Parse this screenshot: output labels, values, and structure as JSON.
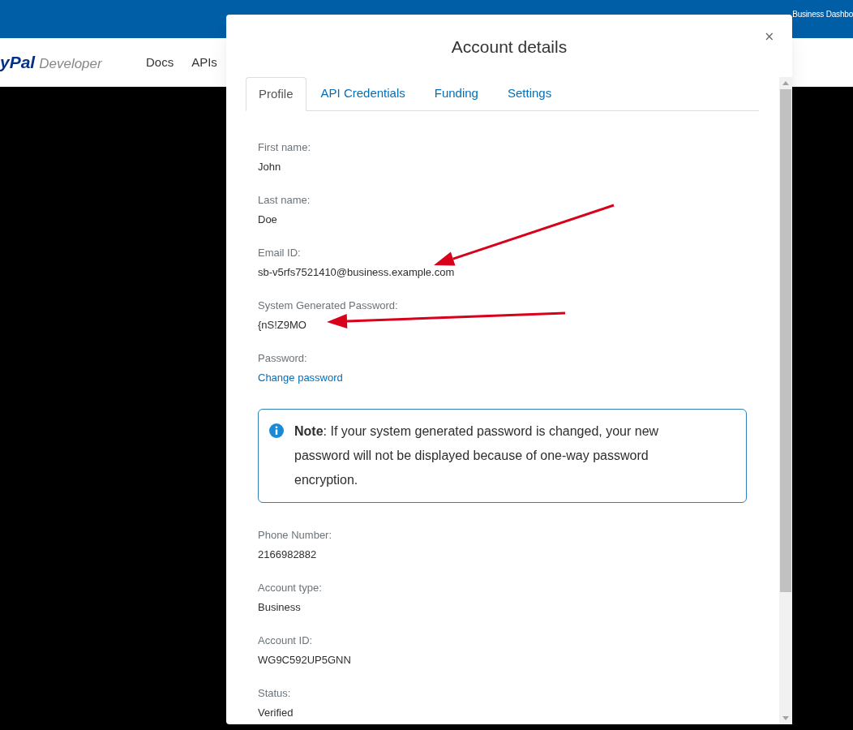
{
  "top_bar": {
    "link": "Business Dashbo"
  },
  "nav": {
    "logo_brand": "yPal",
    "logo_suffix": "Developer",
    "items": [
      "Docs",
      "APIs"
    ]
  },
  "modal": {
    "title": "Account details",
    "close": "×",
    "tabs": [
      {
        "label": "Profile",
        "selected": true
      },
      {
        "label": "API Credentials",
        "selected": false
      },
      {
        "label": "Funding",
        "selected": false
      },
      {
        "label": "Settings",
        "selected": false
      }
    ],
    "fields_top": [
      {
        "label": "First name:",
        "value": "John"
      },
      {
        "label": "Last name:",
        "value": "Doe"
      },
      {
        "label": "Email ID:",
        "value": "sb-v5rfs7521410@business.example.com"
      },
      {
        "label": "System Generated Password:",
        "value": "{nS!Z9MO"
      }
    ],
    "password": {
      "label": "Password:",
      "link": "Change password"
    },
    "note": "**Note**: If your system generated password is changed, your new password will not be displayed because of one-way password encryption.",
    "fields_bottom": [
      {
        "label": "Phone Number:",
        "value": "2166982882"
      },
      {
        "label": "Account type:",
        "value": "Business"
      },
      {
        "label": "Account ID:",
        "value": "WG9C592UP5GNN"
      },
      {
        "label": "Status:",
        "value": "Verified"
      }
    ]
  },
  "annotations": [
    {
      "kind": "arrow"
    },
    {
      "kind": "arrow"
    }
  ]
}
